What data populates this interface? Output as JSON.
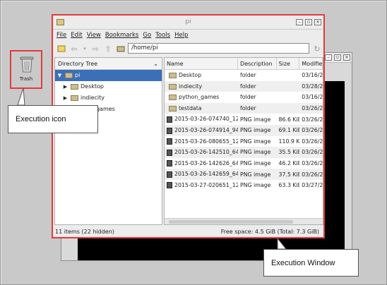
{
  "window": {
    "title": "pi",
    "menus": [
      "File",
      "Edit",
      "View",
      "Bookmarks",
      "Go",
      "Tools",
      "Help"
    ],
    "path": "/home/pi",
    "status_left": "11 items (22 hidden)",
    "status_right": "Free space: 4.5 GiB (Total: 7.3 GiB)"
  },
  "dir_tree": {
    "header": "Directory Tree",
    "items": [
      {
        "label": "pi",
        "expander": "▼",
        "selected": true
      },
      {
        "label": "Desktop",
        "expander": "▶"
      },
      {
        "label": "indiecity",
        "expander": "▶"
      },
      {
        "label": "on_games",
        "expander": ""
      },
      {
        "label": "ata",
        "expander": ""
      }
    ]
  },
  "file_list": {
    "columns": [
      "Name",
      "Description",
      "Size",
      "Modifie"
    ],
    "rows": [
      {
        "name": "Desktop",
        "desc": "folder",
        "size": "",
        "mod": "03/16/2",
        "icon": "folder"
      },
      {
        "name": "indiecity",
        "desc": "folder",
        "size": "",
        "mod": "03/28/2",
        "icon": "folder"
      },
      {
        "name": "python_games",
        "desc": "folder",
        "size": "",
        "mod": "03/16/2",
        "icon": "folder"
      },
      {
        "name": "testdata",
        "desc": "folder",
        "size": "",
        "mod": "03/26/2",
        "icon": "folder"
      },
      {
        "name": "2015-03-26-074740_12...",
        "desc": "PNG image",
        "size": "86.6 KiB",
        "mod": "03/26/2",
        "icon": "image"
      },
      {
        "name": "2015-03-26-074914_94...",
        "desc": "PNG image",
        "size": "69.1 KiB",
        "mod": "03/26/2",
        "icon": "image"
      },
      {
        "name": "2015-03-26-080655_12...",
        "desc": "PNG image",
        "size": "110.9 KiB",
        "mod": "03/26/2",
        "icon": "image"
      },
      {
        "name": "2015-03-26-142510_64...",
        "desc": "PNG image",
        "size": "35.5 KiB",
        "mod": "03/26/2",
        "icon": "image"
      },
      {
        "name": "2015-03-26-142626_64...",
        "desc": "PNG image",
        "size": "46.2 KiB",
        "mod": "03/26/2",
        "icon": "image"
      },
      {
        "name": "2015-03-26-142659_64...",
        "desc": "PNG image",
        "size": "37.5 KiB",
        "mod": "03/26/2",
        "icon": "image"
      },
      {
        "name": "2015-03-27-020651_12...",
        "desc": "PNG image",
        "size": "63.3 KiB",
        "mod": "03/27/2",
        "icon": "image"
      }
    ]
  },
  "desktop": {
    "trash_label": "Trash"
  },
  "annotations": {
    "icon_callout": "Execution icon",
    "window_callout": "Execution Window"
  },
  "colors": {
    "highlight": "#e23a3a",
    "selection": "#3b6fb8"
  }
}
